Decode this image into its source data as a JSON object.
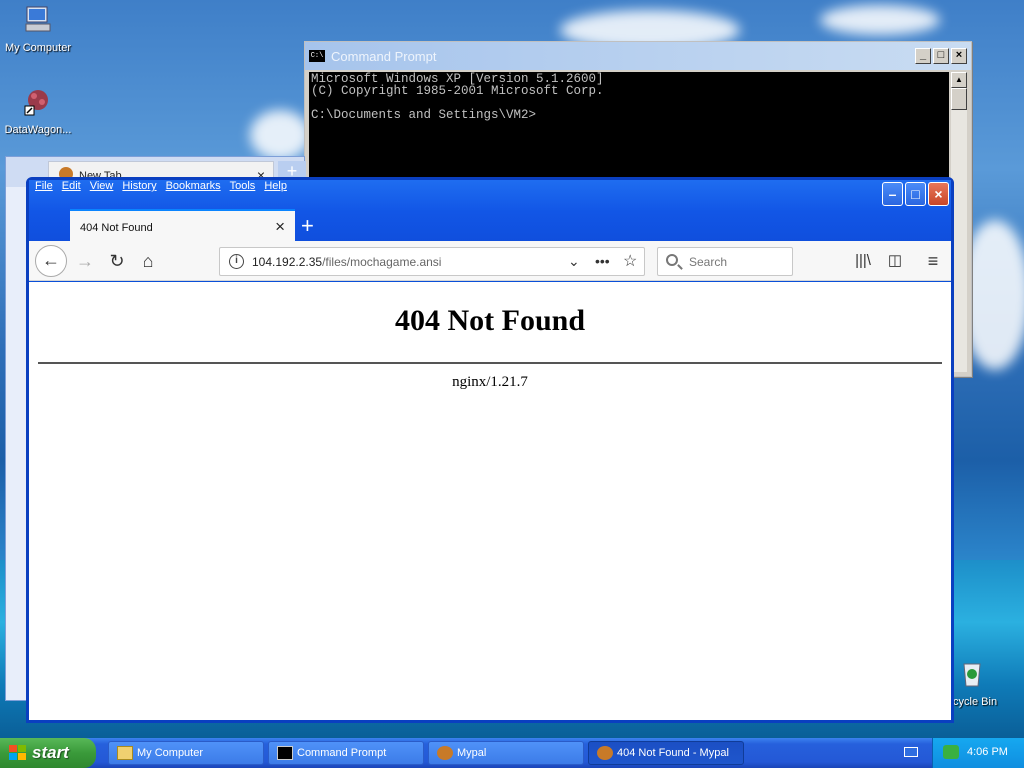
{
  "desktop": {
    "icons": [
      {
        "label": "My Computer",
        "icon": "my-computer-icon"
      },
      {
        "label": "DataWagon...",
        "icon": "datawagon-icon"
      },
      {
        "label": "ecycle Bin",
        "icon": "recycle-bin-icon"
      }
    ]
  },
  "cmd": {
    "title": "Command Prompt",
    "title_icon": "C:\\",
    "lines": "Microsoft Windows XP [Version 5.1.2600]\n(C) Copyright 1985-2001 Microsoft Corp.\n\nC:\\Documents and Settings\\VM2>",
    "min": "_",
    "max": "□",
    "close": "×"
  },
  "bg_browser": {
    "tab_label": "New Tab",
    "tab_close": "×",
    "new_tab": "+"
  },
  "browser": {
    "menu": [
      "File",
      "Edit",
      "View",
      "History",
      "Bookmarks",
      "Tools",
      "Help"
    ],
    "tab_label": "404 Not Found",
    "tab_close": "×",
    "new_tab": "+",
    "url_host": "104.192.2.35",
    "url_path": "/files/mochagame.ansi",
    "search_placeholder": "Search",
    "page": {
      "heading": "404 Not Found",
      "server": "nginx/1.21.7"
    }
  },
  "taskbar": {
    "start": "start",
    "buttons": [
      {
        "label": "My Computer",
        "active": false
      },
      {
        "label": "Command Prompt",
        "active": false
      },
      {
        "label": "Mypal",
        "active": false
      },
      {
        "label": "404 Not Found - Mypal",
        "active": true
      }
    ],
    "clock": "4:06 PM"
  }
}
